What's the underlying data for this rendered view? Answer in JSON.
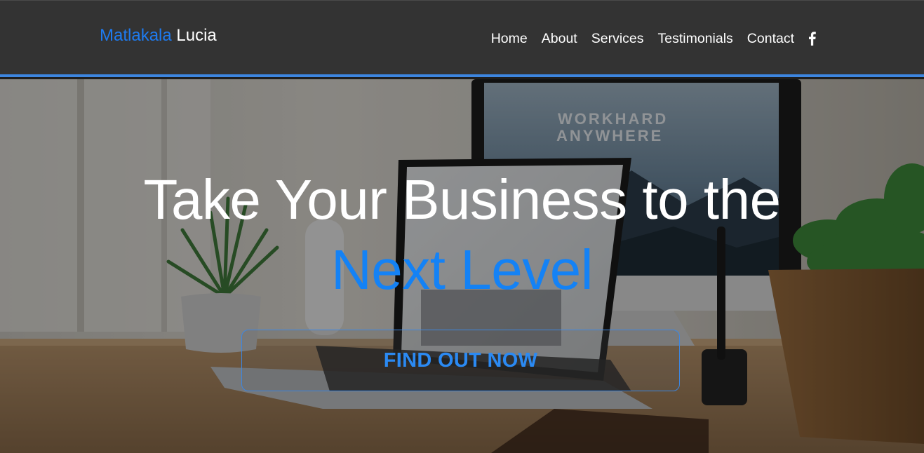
{
  "header": {
    "brand_first": "Matlakala",
    "brand_last": " Lucia",
    "nav": [
      {
        "label": "Home"
      },
      {
        "label": "About"
      },
      {
        "label": "Services"
      },
      {
        "label": "Testimonials"
      },
      {
        "label": "Contact"
      }
    ],
    "social_icon": "facebook-icon"
  },
  "hero": {
    "title_line1": "Take Your Business to the",
    "title_line2": "Next Level",
    "cta_label": "FIND OUT NOW",
    "background_image": "desk with laptop, monitor and plants",
    "monitor_text_1": "WORKHARD",
    "monitor_text_2": "ANYWHERE"
  },
  "colors": {
    "accent": "#1e7bf0",
    "navbar": "#333333",
    "nav_border": "#3d86e0",
    "text": "#ffffff"
  }
}
